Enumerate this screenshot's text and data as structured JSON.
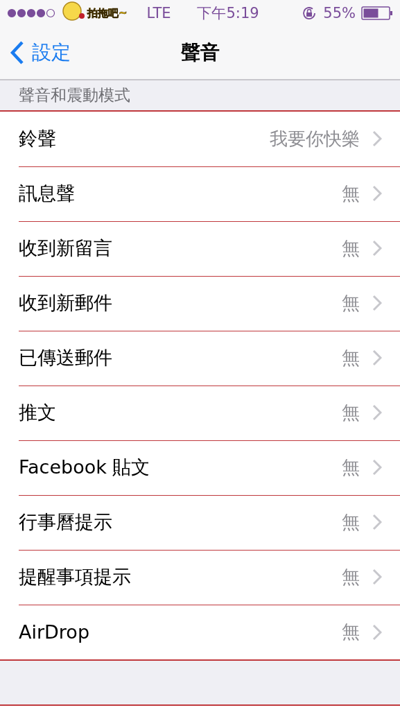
{
  "status_bar": {
    "carrier_logo": "拍拖吧~",
    "network": "LTE",
    "time": "下午5:19",
    "battery": "55%"
  },
  "nav_bar": {
    "back": "設定",
    "title": "聲音"
  },
  "section": {
    "header": "聲音和震動模式",
    "rows": [
      {
        "label": "鈴聲",
        "value": "我要你快樂"
      },
      {
        "label": "訊息聲",
        "value": "無"
      },
      {
        "label": "收到新留言",
        "value": "無"
      },
      {
        "label": "收到新郵件",
        "value": "無"
      },
      {
        "label": "已傳送郵件",
        "value": "無"
      },
      {
        "label": "推文",
        "value": "無"
      },
      {
        "label": "Facebook 貼文",
        "value": "無"
      },
      {
        "label": "行事曆提示",
        "value": "無"
      },
      {
        "label": "提醒事項提示",
        "value": "無"
      },
      {
        "label": "AirDrop",
        "value": "無"
      }
    ]
  }
}
